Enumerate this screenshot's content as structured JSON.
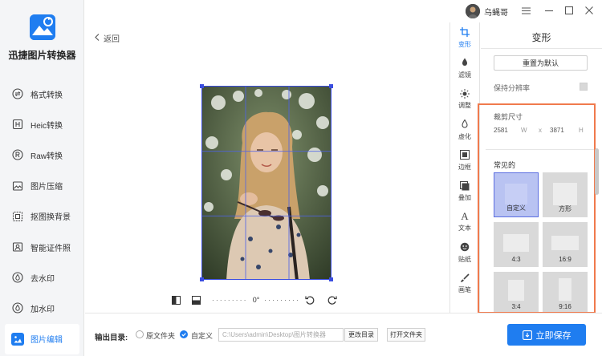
{
  "app": {
    "title": "迅捷图片转换器"
  },
  "user": {
    "name": "乌蝇哥"
  },
  "window": {
    "menu_icon": "menu-icon",
    "minimize_icon": "minimize-icon",
    "maximize_icon": "maximize-icon",
    "close_icon": "close-icon"
  },
  "sidebar": {
    "items": [
      {
        "label": "格式转换",
        "icon": "format-convert-icon",
        "active": false
      },
      {
        "label": "Heic转换",
        "icon": "heic-icon",
        "active": false
      },
      {
        "label": "Raw转换",
        "icon": "raw-icon",
        "active": false
      },
      {
        "label": "图片压缩",
        "icon": "compress-icon",
        "active": false
      },
      {
        "label": "抠图换背景",
        "icon": "cutout-icon",
        "active": false
      },
      {
        "label": "智能证件照",
        "icon": "id-photo-icon",
        "active": false
      },
      {
        "label": "去水印",
        "icon": "remove-watermark-icon",
        "active": false
      },
      {
        "label": "加水印",
        "icon": "add-watermark-icon",
        "active": false
      },
      {
        "label": "图片编辑",
        "icon": "image-edit-icon",
        "active": true
      }
    ]
  },
  "main": {
    "back_label": "返回",
    "rotation_value": "0°"
  },
  "tool_strip": {
    "items": [
      {
        "label": "变形",
        "icon": "crop-icon",
        "active": true
      },
      {
        "label": "滤镜",
        "icon": "filter-icon",
        "active": false
      },
      {
        "label": "调整",
        "icon": "adjust-icon",
        "active": false
      },
      {
        "label": "虚化",
        "icon": "blur-icon",
        "active": false
      },
      {
        "label": "边框",
        "icon": "border-icon",
        "active": false
      },
      {
        "label": "叠加",
        "icon": "overlay-icon",
        "active": false
      },
      {
        "label": "文本",
        "icon": "text-icon",
        "active": false
      },
      {
        "label": "贴纸",
        "icon": "sticker-icon",
        "active": false
      },
      {
        "label": "画笔",
        "icon": "brush-icon",
        "active": false
      }
    ]
  },
  "panel": {
    "title": "变形",
    "reset_label": "重置为默认",
    "keep_resolution_label": "保持分辨率",
    "crop_size_label": "裁剪尺寸",
    "width_value": "2581",
    "width_unit": "W",
    "times": "x",
    "height_value": "3871",
    "height_unit": "H",
    "common_label": "常见的",
    "presets": [
      {
        "label": "自定义",
        "selected": true
      },
      {
        "label": "方形",
        "selected": false
      },
      {
        "label": "4:3",
        "selected": false
      },
      {
        "label": "16:9",
        "selected": false
      },
      {
        "label": "3:4",
        "selected": false
      },
      {
        "label": "9:16",
        "selected": false
      }
    ]
  },
  "bottom": {
    "output_label": "输出目录:",
    "source_folder_label": "原文件夹",
    "custom_label": "自定义",
    "path_value": "C:\\Users\\admin\\Desktop\\图片转换器",
    "change_dir_label": "更改目录",
    "open_folder_label": "打开文件夹",
    "save_label": "立即保存"
  },
  "colors": {
    "accent": "#1f7df0",
    "highlight": "#f07a4d",
    "crop_frame": "#3a4de0"
  }
}
